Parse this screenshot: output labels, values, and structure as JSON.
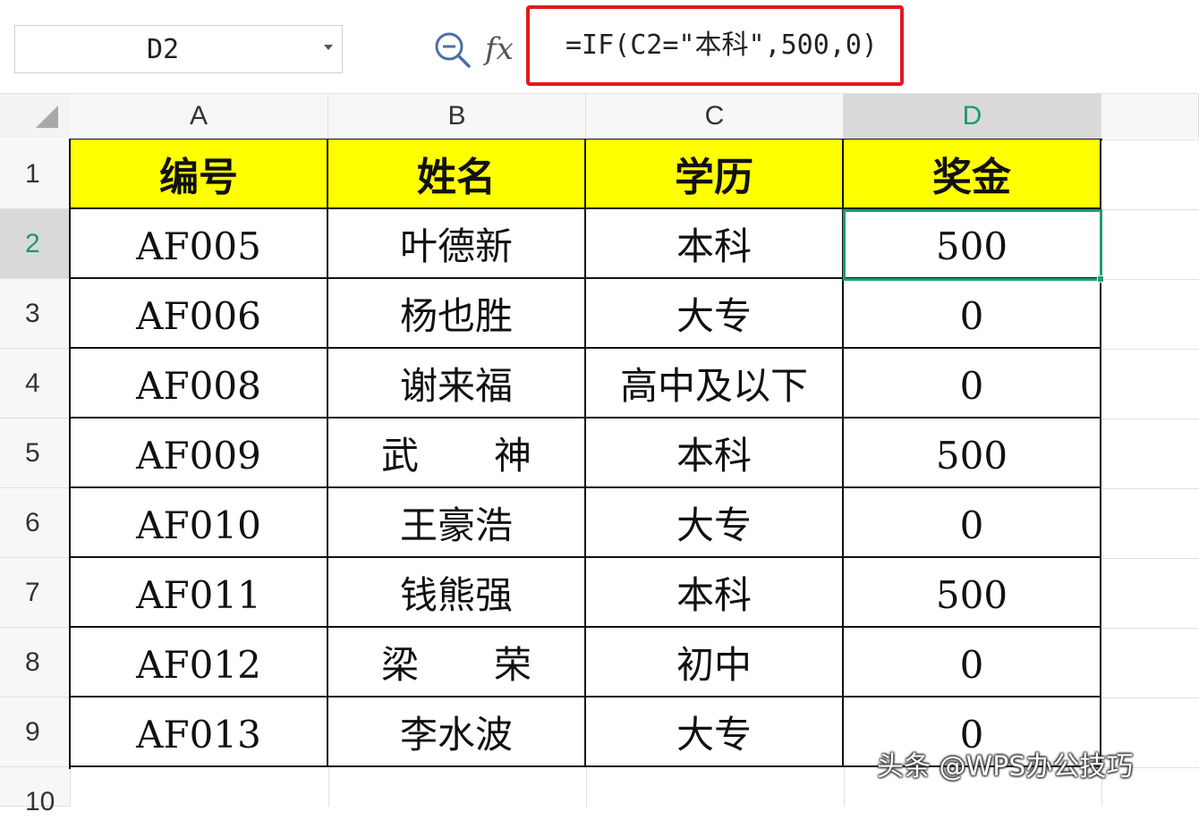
{
  "name_box": {
    "value": "D2"
  },
  "formula_bar": {
    "fx": "fx",
    "formula": "=IF(C2=\"本科\",500,0)"
  },
  "columns": [
    "A",
    "B",
    "C",
    "D"
  ],
  "selected_column": "D",
  "rows": [
    "1",
    "2",
    "3",
    "4",
    "5",
    "6",
    "7",
    "8",
    "9",
    "10"
  ],
  "selected_row": "2",
  "table": {
    "headers": [
      "编号",
      "姓名",
      "学历",
      "奖金"
    ],
    "rows": [
      [
        "AF005",
        "叶德新",
        "本科",
        "500"
      ],
      [
        "AF006",
        "杨也胜",
        "大专",
        "0"
      ],
      [
        "AF008",
        "谢来福",
        "高中及以下",
        "0"
      ],
      [
        "AF009",
        "武　　神",
        "本科",
        "500"
      ],
      [
        "AF010",
        "王豪浩",
        "大专",
        "0"
      ],
      [
        "AF011",
        "钱熊强",
        "本科",
        "500"
      ],
      [
        "AF012",
        "梁　　荣",
        "初中",
        "0"
      ],
      [
        "AF013",
        "李水波",
        "大专",
        "0"
      ]
    ]
  },
  "selected_cell": "D2",
  "watermark": "头条 @WPS办公技巧",
  "colors": {
    "header_fill": "#ffff00",
    "selection": "#1f9d6e",
    "formula_highlight": "#e0191e"
  }
}
